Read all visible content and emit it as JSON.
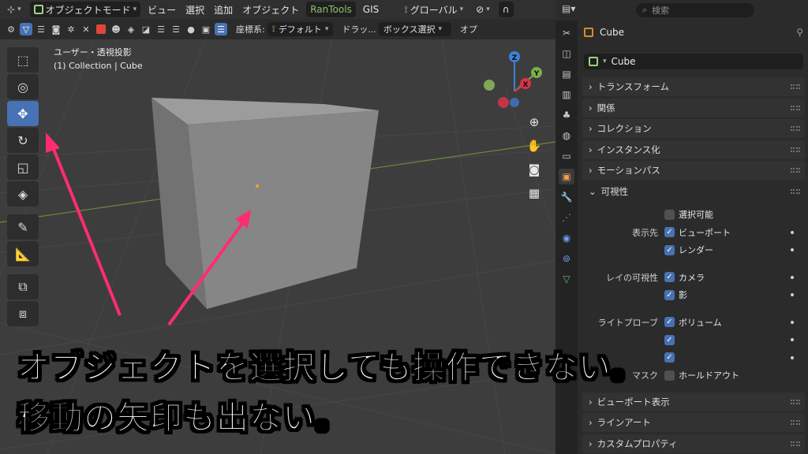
{
  "header": {
    "mode_label": "オブジェクトモード",
    "menus": [
      "ビュー",
      "選択",
      "追加",
      "オブジェクト"
    ],
    "addon_menu": "RanTools",
    "gis_menu": "GIS",
    "transform_orientation": "グローバル"
  },
  "toolbar2": {
    "coord_label": "座標系:",
    "coord_value": "デフォルト",
    "drag_label": "ドラッ...",
    "drag_value": "ボックス選択",
    "options_label": "オプ"
  },
  "viewport": {
    "view_name": "ユーザー・透視投影",
    "collection_info": "(1) Collection | Cube",
    "gizmo": {
      "x": "X",
      "y": "Y",
      "z": "Z"
    }
  },
  "tools": [
    "select-box",
    "cursor",
    "move",
    "rotate",
    "scale",
    "transform",
    "annotate",
    "measure",
    "add-cube",
    "extrude"
  ],
  "properties": {
    "search_placeholder": "検索",
    "object_title": "Cube",
    "object_name": "Cube",
    "sections": [
      "トランスフォーム",
      "関係",
      "コレクション",
      "インスタンス化",
      "モーションパス"
    ],
    "visibility": {
      "title": "可視性",
      "selectable": "選択可能",
      "show_in_label": "表示先",
      "viewport": "ビューポート",
      "render": "レンダー",
      "ray_label": "レイの可視性",
      "camera": "カメラ",
      "shadow": "影",
      "light_probes_label": "ライトプローブ",
      "volume": "ボリューム",
      "mask_label": "マスク",
      "holdout": "ホールドアウト"
    },
    "bottom_sections": [
      "ビューポート表示",
      "ラインアート",
      "カスタムプロパティ"
    ]
  },
  "caption": {
    "line1": "オブジェクトを選択しても操作できない。",
    "line2": "移動の矢印も出ない。"
  },
  "colors": {
    "accent_blue": "#4772b3",
    "arrow_pink": "#ff2d6e",
    "object_orange": "#d98a2c"
  }
}
